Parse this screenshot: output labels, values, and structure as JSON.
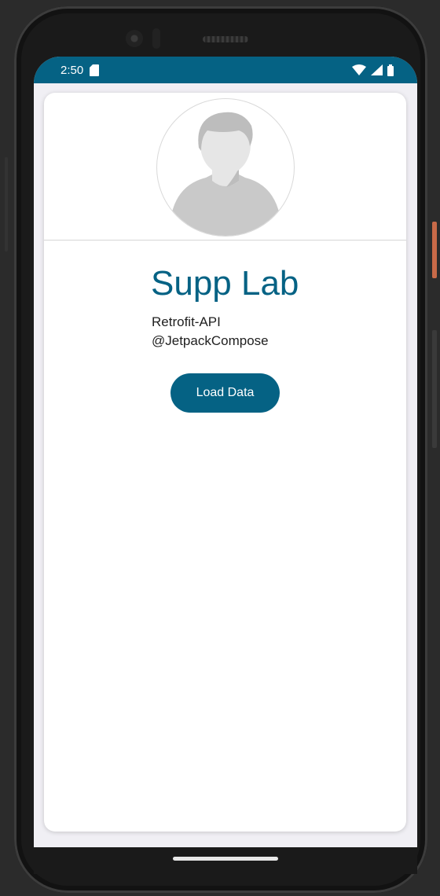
{
  "status_bar": {
    "time": "2:50",
    "background_color": "#056284",
    "icons": [
      "sd-card-icon",
      "wifi-icon",
      "cell-signal-icon",
      "battery-icon"
    ]
  },
  "profile": {
    "avatar_icon": "user-avatar-icon",
    "name": "Supp Lab",
    "line1": "Retrofit-API",
    "line2": "@JetpackCompose"
  },
  "actions": {
    "load_label": "Load Data"
  },
  "colors": {
    "primary": "#056284",
    "card": "#ffffff",
    "screen_bg": "#f0eff4"
  }
}
